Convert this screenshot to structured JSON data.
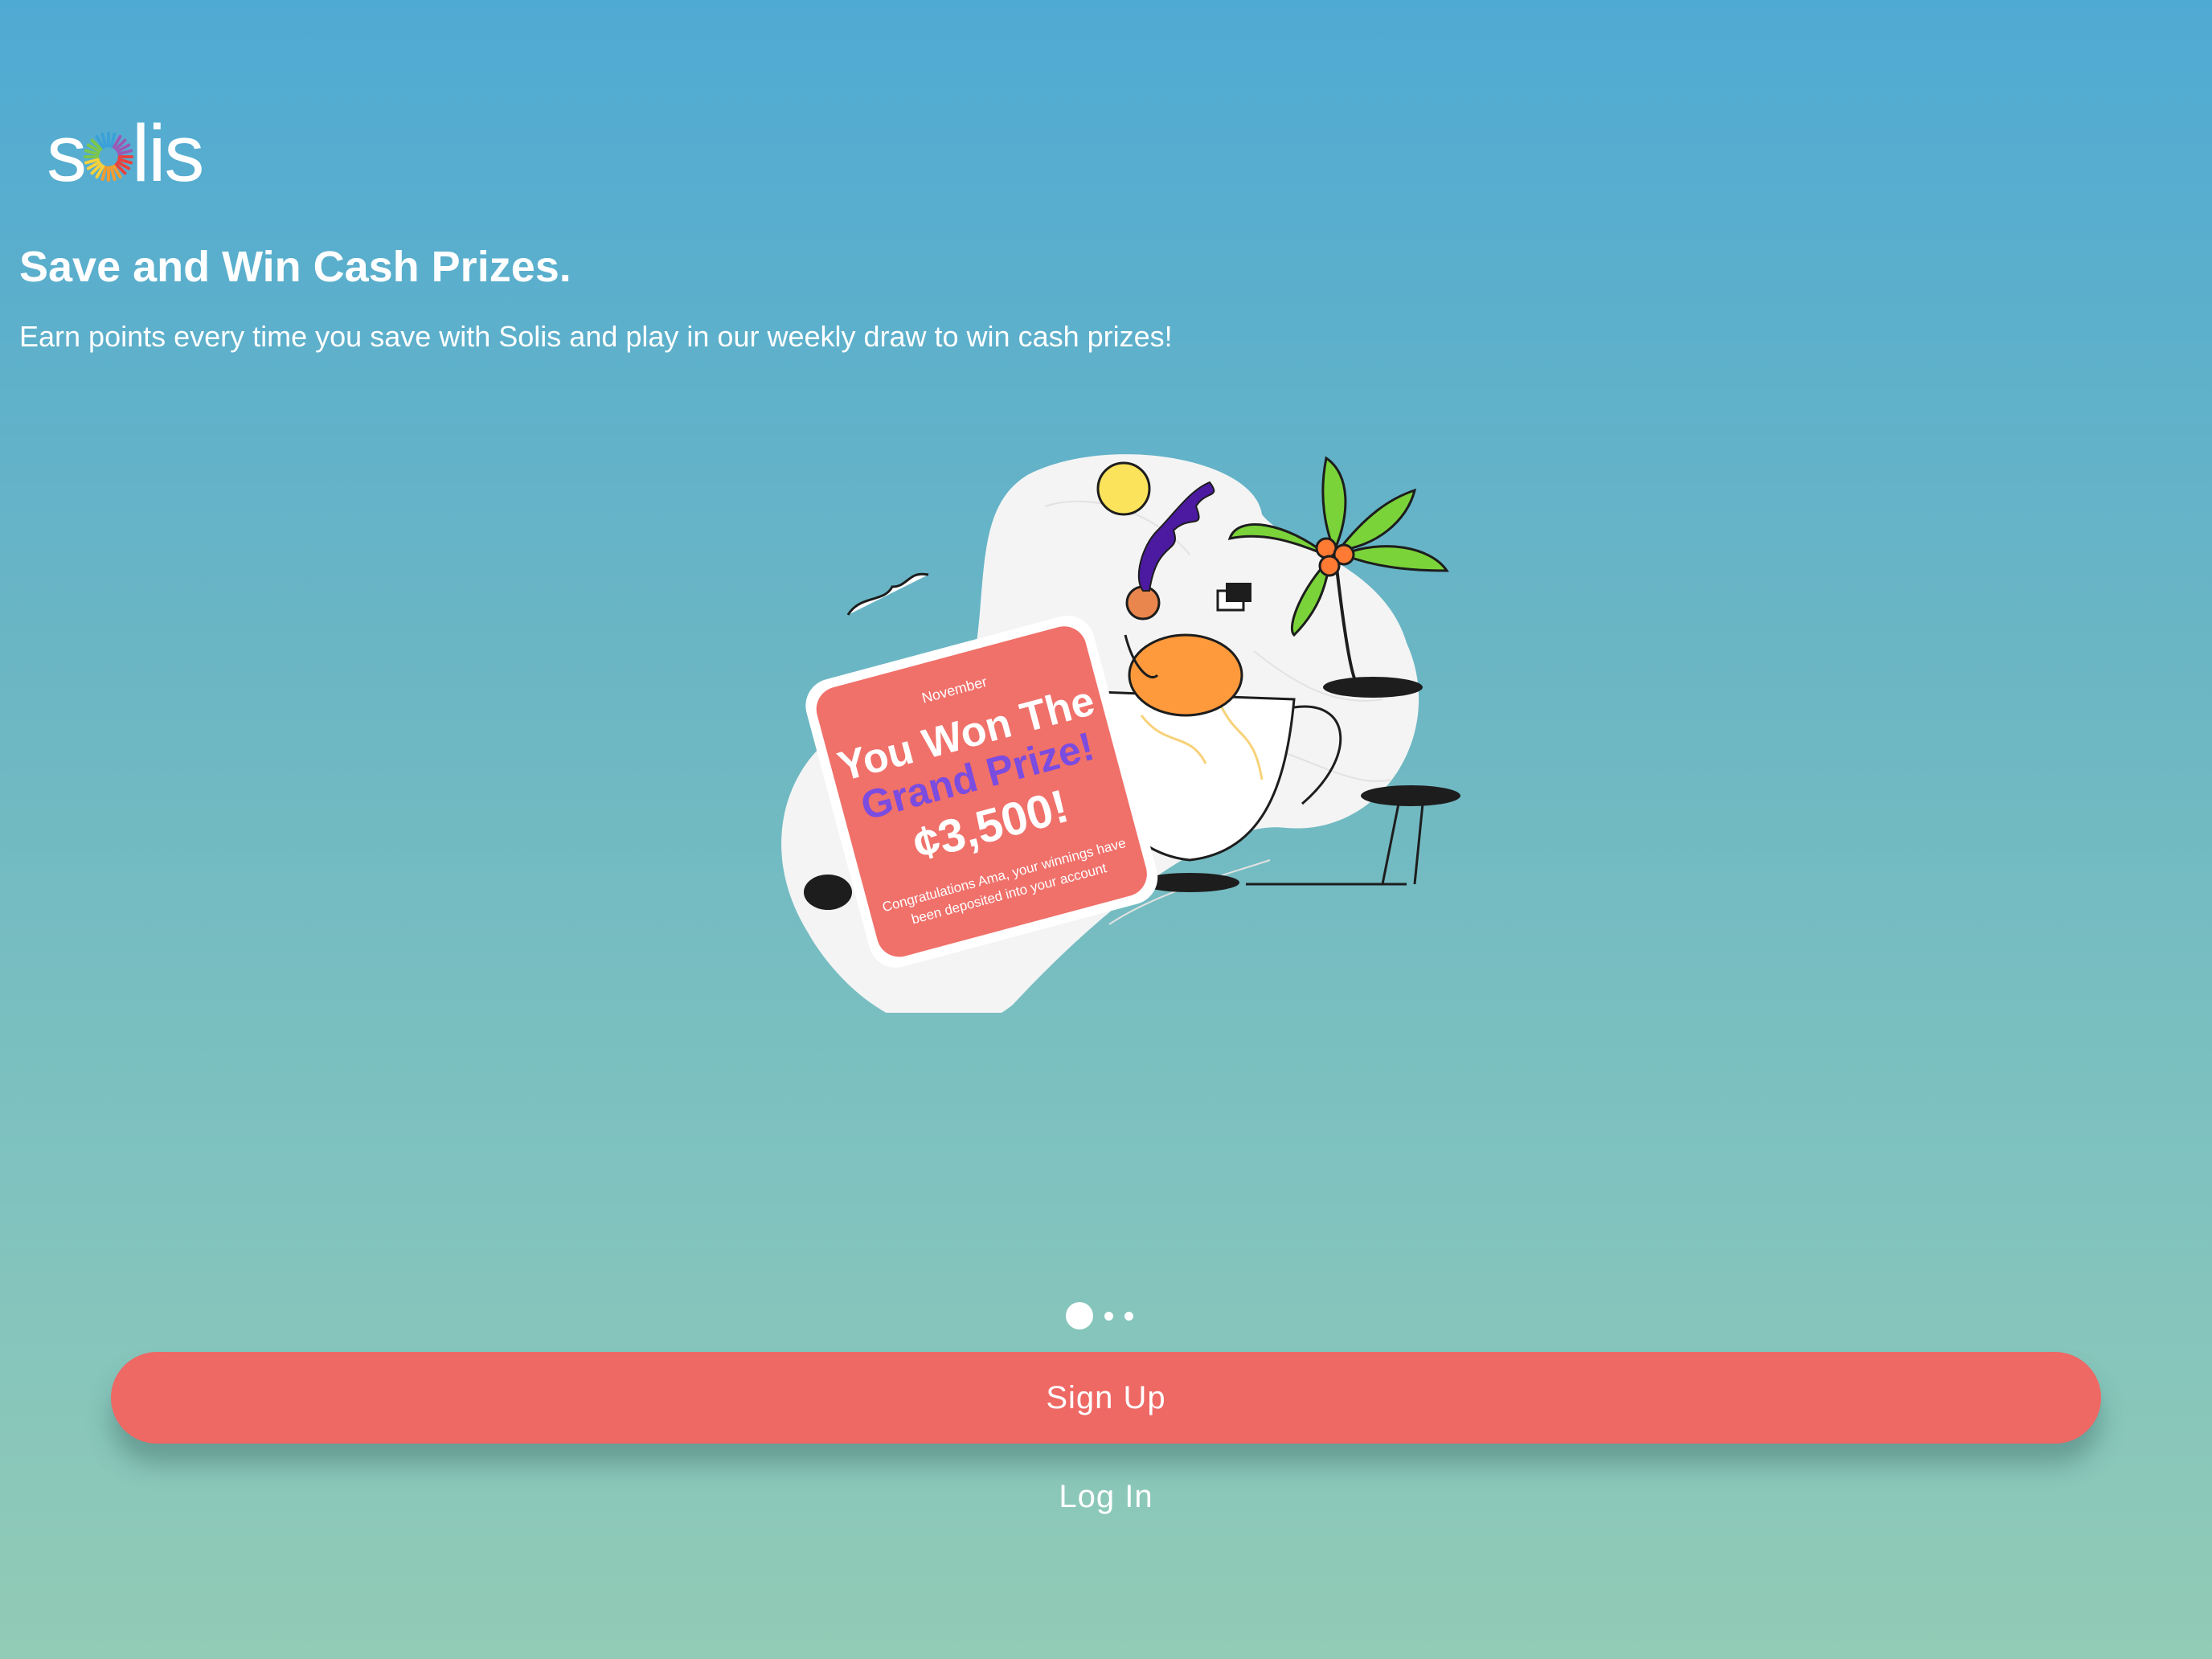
{
  "brand": {
    "logo_left": "s",
    "logo_right": "lis",
    "logo_name": "solis",
    "logo_icon": "sun-burst-icon",
    "sun_colors": [
      "#e8423f",
      "#f39c2f",
      "#f7d13a",
      "#7cc64c",
      "#3aa0d8",
      "#9b59b6"
    ]
  },
  "onboarding": {
    "title": "Save and Win Cash Prizes.",
    "description": "Earn points every time you save with Solis and play in our weekly draw to win cash prizes!"
  },
  "illustration": {
    "card_month": "November",
    "card_line1": "You Won The",
    "card_line2": "Grand Prize!",
    "card_amount": "¢3,500!",
    "card_footer1": "Congratulations Ama, your winnings have",
    "card_footer2": "been deposited into your account",
    "card_color": "#f0706a",
    "highlight_color": "#7a4ce0",
    "blob_color": "#f3f3f3"
  },
  "pager": {
    "total": 3,
    "active_index": 0
  },
  "actions": {
    "signup_label": "Sign Up",
    "login_label": "Log In",
    "primary_color": "#ee6864"
  }
}
